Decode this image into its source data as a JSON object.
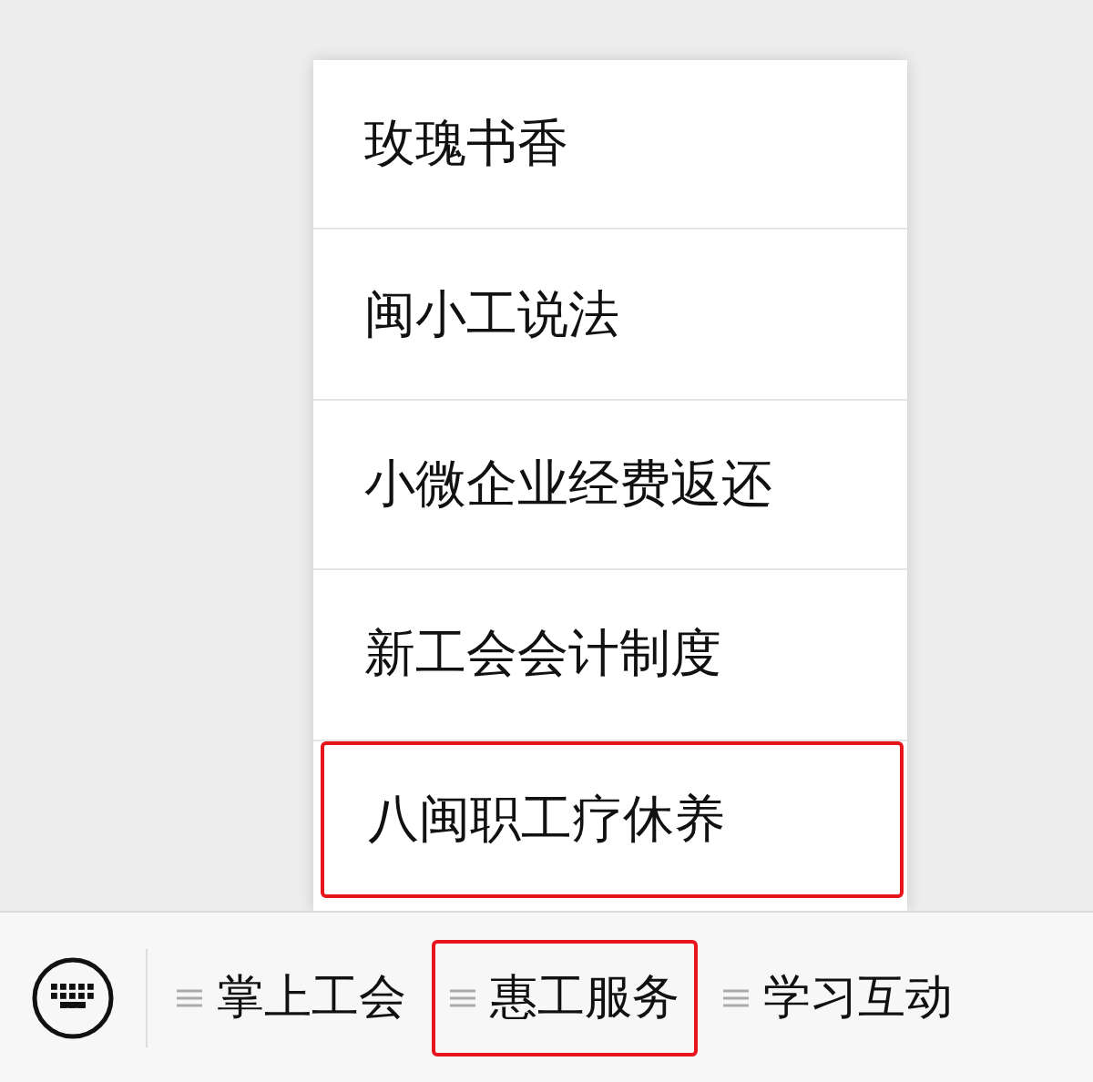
{
  "submenu": {
    "items": [
      {
        "label": "玫瑰书香",
        "highlighted": false
      },
      {
        "label": "闽小工说法",
        "highlighted": false
      },
      {
        "label": "小微企业经费返还",
        "highlighted": false
      },
      {
        "label": "新工会会计制度",
        "highlighted": false
      },
      {
        "label": "八闽职工疗休养",
        "highlighted": true
      }
    ]
  },
  "menu_bar": {
    "items": [
      {
        "label": "掌上工会",
        "selected": false
      },
      {
        "label": "惠工服务",
        "selected": true
      },
      {
        "label": "学习互动",
        "selected": false
      }
    ]
  }
}
